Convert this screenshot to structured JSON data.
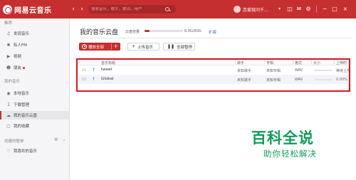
{
  "app": {
    "name": "网易云音乐"
  },
  "header": {
    "search_placeholder": "搜索音乐，歌手，歌词，用户",
    "username": "恋爱就问千…",
    "icons": [
      "back-icon",
      "forward-icon",
      "skin-icon",
      "mail-icon",
      "settings-icon",
      "minimize-icon",
      "maximize-icon",
      "close-icon"
    ],
    "brand_color": "#c62f2f"
  },
  "sidebar": {
    "section_recommend": "推荐",
    "recommend_items": [
      {
        "label": "发现音乐",
        "icon": "music-note-icon"
      },
      {
        "label": "私人FM",
        "icon": "radio-icon"
      },
      {
        "label": "视频",
        "icon": "video-icon"
      },
      {
        "label": "朋友",
        "icon": "friends-icon"
      }
    ],
    "section_my_music": "我的音乐",
    "my_music_items": [
      {
        "label": "本地音乐",
        "icon": "local-music-icon"
      },
      {
        "label": "下载管理",
        "icon": "download-icon"
      },
      {
        "label": "我的音乐云盘",
        "icon": "cloud-icon"
      },
      {
        "label": "我的收藏",
        "icon": "collection-icon"
      }
    ],
    "section_playlists": "创建的歌单",
    "playlist_items": [
      {
        "label": "我喜欢的音乐",
        "icon": "heart-icon"
      }
    ]
  },
  "main": {
    "title": "我的音乐云盘",
    "capacity_label": "云盘容量",
    "capacity_value": "8.0G/60G",
    "capacity_fraction": 0.13,
    "expand_link": "扩容",
    "buttons": {
      "play_all": "播放全部",
      "upload": "上传音乐",
      "pause_all": "全部暂停"
    },
    "table": {
      "columns": [
        "音乐标题",
        "歌手",
        "专辑",
        "格式",
        "大小",
        "上传时间"
      ],
      "rows": [
        {
          "index": "01",
          "title": "tweet",
          "artist": "未知歌手",
          "album": "未知专辑",
          "format": "WAV",
          "progress": 0.0,
          "status": "等待上传"
        },
        {
          "index": "02",
          "title": "Global",
          "artist": "未知歌手",
          "album": "未知专辑",
          "format": "WAV",
          "progress": 0.0,
          "status": "0.00%"
        }
      ]
    }
  },
  "watermark": {
    "title": "百科全说",
    "subtitle": "助你轻松解决",
    "color": "#129b5b"
  }
}
